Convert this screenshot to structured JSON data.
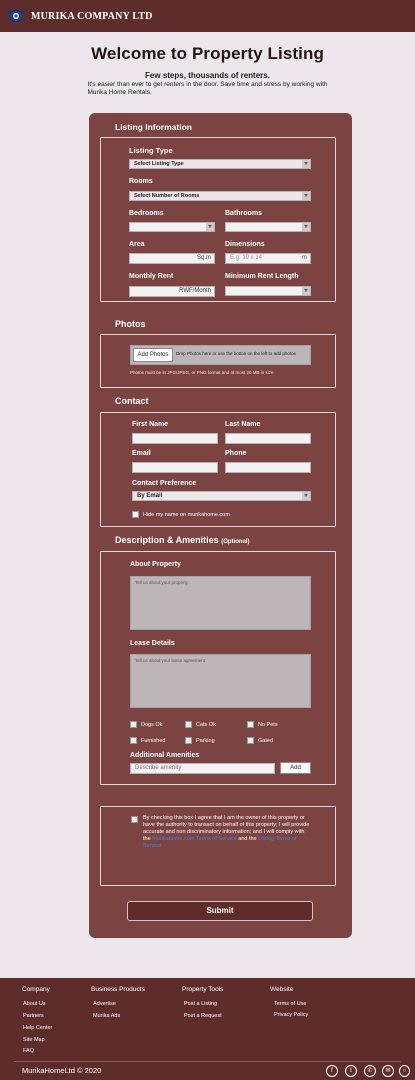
{
  "header": {
    "brand": "MURIKA COMPANY LTD"
  },
  "hero": {
    "title": "Welcome to Property Listing",
    "tagline": "Few steps, thousands of renters.",
    "description": "It's easier than  ever to get  renters in the door.  Save  time  and  stress by working with Murika Home Rentals."
  },
  "listing": {
    "section_title": "Listing Information",
    "listing_type_label": "Listing Type",
    "listing_type_value": "Select Listing Type",
    "rooms_label": "Rooms",
    "rooms_value": "Select Number of Rooms",
    "bedrooms_label": "Bedrooms",
    "bathrooms_label": "Bathrooms",
    "area_label": "Area",
    "area_unit": "Sq.m",
    "dimensions_label": "Dimensions",
    "dimensions_placeholder": "E.g: 19 x 14",
    "dimensions_unit": "m",
    "rent_label": "Monthly Rent",
    "rent_unit": "RWF/Month",
    "min_rent_label": "Minimum Rent Length"
  },
  "photos": {
    "section_title": "Photos",
    "add_button": "Add Photos",
    "drop_text": "Drop Photos here or use the botton on the left to add photos",
    "note": "Photos must be in JPG/JPEG, or PNG format and at most 20 MB in size"
  },
  "contact": {
    "section_title": "Contact",
    "first_name_label": "First Name",
    "last_name_label": "Last Name",
    "email_label": "Email",
    "phone_label": "Phone",
    "preference_label": "Contact Preference",
    "preference_value": "By Email",
    "hide_name_label": "Hide my name on murikahome.com"
  },
  "description": {
    "section_title": "Description & Amenities",
    "optional": "(Optional)",
    "about_label": "About Property",
    "about_placeholder": "Tell us about your property",
    "lease_label": "Lease Details",
    "lease_placeholder": "Tell us about your lease agreement",
    "amenities": [
      "Dogs Ok",
      "Cats Ok",
      "No Pets",
      "Furnished",
      "Parking",
      "Gated"
    ],
    "additional_label": "Additional Amenities",
    "amenity_placeholder": "Describe amenity",
    "add_button": "Add"
  },
  "agreement": {
    "text_1": "By checking this box I agree that I am the owner of this property or have the authority to transact on behalf of this property; I will provide accurate and non discriminatory information; and I will comply with the",
    "link_1": "murikahome.com Terms of Service",
    "text_2": "and the",
    "link_2": "Listing Terms of Service."
  },
  "submit_label": "Submit",
  "footer": {
    "columns": [
      {
        "title": "Company",
        "links": [
          "About Us",
          "Partners",
          "Help Center",
          "Site Map",
          "FAQ"
        ]
      },
      {
        "title": "Business Products",
        "links": [
          "Advertise",
          "Murika Ads"
        ]
      },
      {
        "title": "Property Tools",
        "links": [
          "Post a Listing",
          "Post a Request"
        ]
      },
      {
        "title": "Website",
        "links": [
          "Terms of Use",
          "Privacy Policy"
        ]
      }
    ],
    "copyright": "MurikaHomeLtd  © 2020",
    "social_icons": [
      "facebook-icon",
      "tumblr-icon",
      "whatsapp-icon",
      "mail-icon",
      "instagram-icon"
    ]
  },
  "colors": {
    "primary": "#5f2c2c",
    "card": "#7b4341",
    "background": "#ede6ea",
    "link": "#4a86d6"
  }
}
